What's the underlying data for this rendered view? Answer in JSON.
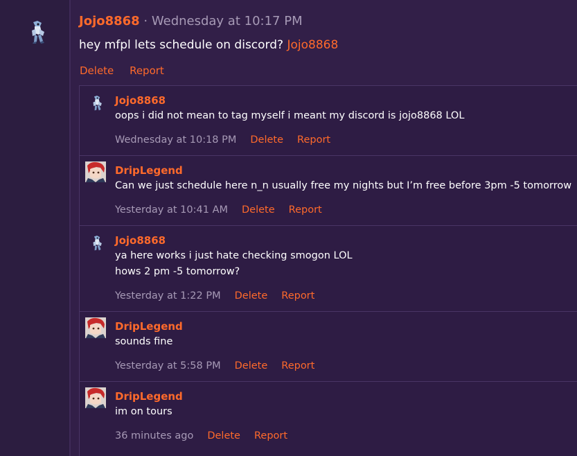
{
  "main_post": {
    "username": "Jojo8868",
    "separator": " · ",
    "timestamp": "Wednesday at 10:17 PM",
    "text": "hey mfpl lets schedule on discord? ",
    "mention": "Jojo8868",
    "delete_label": "Delete",
    "report_label": "Report"
  },
  "replies": [
    {
      "username": "Jojo8868",
      "lines": [
        "oops i did not mean to tag myself i meant my discord is jojo8868 LOL"
      ],
      "timestamp": "Wednesday at 10:18 PM",
      "delete_label": "Delete",
      "report_label": "Report",
      "avatar": "pokemon-sprite"
    },
    {
      "username": "DripLegend",
      "lines": [
        "Can we just schedule here n_n usually free my nights but I’m free before 3pm -5 tomorrow"
      ],
      "timestamp": "Yesterday at 10:41 AM",
      "delete_label": "Delete",
      "report_label": "Report",
      "avatar": "red-haired-anime-avatar"
    },
    {
      "username": "Jojo8868",
      "lines": [
        "ya here works i just hate checking smogon LOL",
        "hows 2 pm -5 tomorrow?"
      ],
      "timestamp": "Yesterday at 1:22 PM",
      "delete_label": "Delete",
      "report_label": "Report",
      "avatar": "pokemon-sprite"
    },
    {
      "username": "DripLegend",
      "lines": [
        "sounds fine"
      ],
      "timestamp": "Yesterday at 5:58 PM",
      "delete_label": "Delete",
      "report_label": "Report",
      "avatar": "red-haired-anime-avatar"
    },
    {
      "username": "DripLegend",
      "lines": [
        "im on tours"
      ],
      "timestamp": "36 minutes ago",
      "delete_label": "Delete",
      "report_label": "Report",
      "avatar": "red-haired-anime-avatar"
    }
  ],
  "colors": {
    "accent": "#ff6a2b",
    "background": "#2a1b3d",
    "meta_text": "#a79ab6"
  }
}
